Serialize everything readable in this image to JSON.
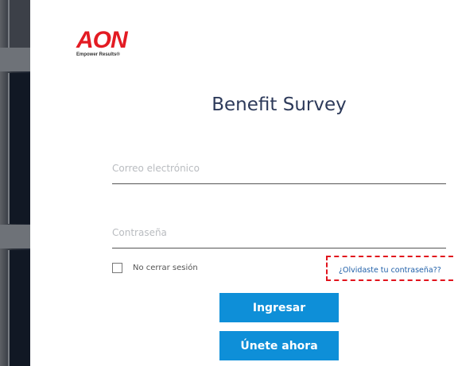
{
  "brand": {
    "logo_text": "AON",
    "tagline": "Empower Results®",
    "accent_color": "#e31b23",
    "button_color": "#0e8fd8"
  },
  "page": {
    "title": "Benefit Survey"
  },
  "form": {
    "email_placeholder": "Correo electrónico",
    "password_placeholder": "Contraseña",
    "remember_label": "No cerrar sesión",
    "forgot_link": "¿Olvidaste tu contraseña??",
    "login_button": "Ingresar",
    "join_button": "Únete ahora"
  },
  "icons": {
    "checkbox": "checkbox-unchecked-icon"
  }
}
